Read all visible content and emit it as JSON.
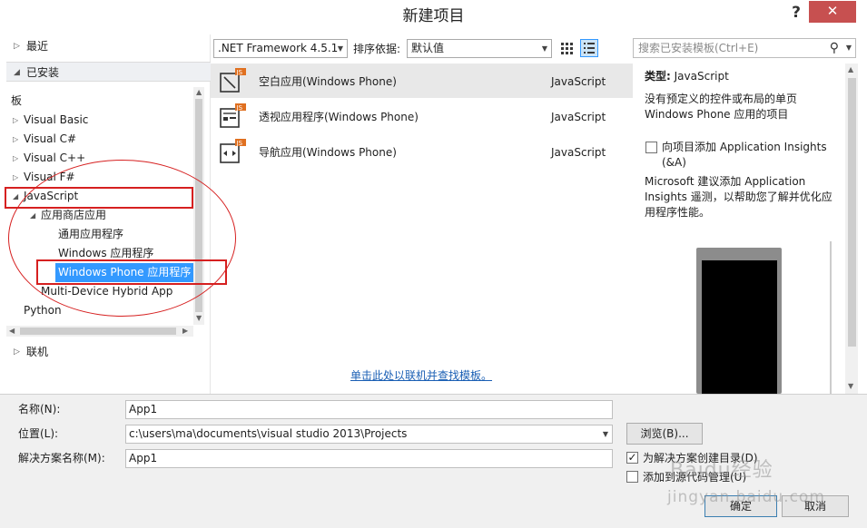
{
  "window": {
    "title": "新建项目",
    "help_label": "?",
    "close_label": "✕"
  },
  "left": {
    "recent_label": "最近",
    "installed_label": "已安装",
    "templates_label": "模板",
    "tree": [
      {
        "label": "Visual Basic"
      },
      {
        "label": "Visual C#"
      },
      {
        "label": "Visual C++"
      },
      {
        "label": "Visual F#"
      },
      {
        "label": "JavaScript"
      },
      {
        "label": "应用商店应用"
      },
      {
        "label": "通用应用程序"
      },
      {
        "label": "Windows 应用程序"
      },
      {
        "label": "Windows Phone 应用程序"
      },
      {
        "label": "Multi-Device Hybrid App"
      },
      {
        "label": "Python"
      }
    ],
    "online_label": "联机"
  },
  "toolbar": {
    "framework_value": ".NET Framework 4.5.1",
    "sort_label": "排序依据:",
    "sort_value": "默认值",
    "search_placeholder": "搜索已安装模板(Ctrl+E)"
  },
  "templates": [
    {
      "name": "空白应用(Windows Phone)",
      "language": "JavaScript",
      "icon": "blank-app-icon"
    },
    {
      "name": "透视应用程序(Windows Phone)",
      "language": "JavaScript",
      "icon": "pivot-app-icon"
    },
    {
      "name": "导航应用(Windows Phone)",
      "language": "JavaScript",
      "icon": "nav-app-icon"
    }
  ],
  "online_link": "单击此处以联机并查找模板。",
  "details": {
    "type_label": "类型:",
    "type_value": "JavaScript",
    "desc_line1": "没有预定义的控件或布局的单页",
    "desc_line2": "Windows Phone 应用的项目",
    "insights_line1": "向项目添加 Application Insights",
    "insights_line2": "(&A)",
    "ms_line1": "Microsoft 建议添加 Application",
    "ms_line2": "Insights 遥测，以帮助您了解并优化应",
    "ms_line3": "用程序性能。"
  },
  "form": {
    "name_label": "名称(N):",
    "name_value": "App1",
    "location_label": "位置(L):",
    "location_value": "c:\\users\\ma\\documents\\visual studio 2013\\Projects",
    "solution_label": "解决方案名称(M):",
    "solution_value": "App1",
    "browse_label": "浏览(B)...",
    "create_dir_label": "为解决方案创建目录(D)",
    "create_dir_checked": true,
    "add_source_label": "添加到源代码管理(U)",
    "add_source_checked": false,
    "ok_label": "确定",
    "cancel_label": "取消"
  },
  "watermark": {
    "line1": "Baidu经验",
    "line2": "jingyan.baidu.com"
  },
  "colors": {
    "selection": "#3399ff",
    "annotation_red": "#d62020",
    "close_button": "#c75050"
  }
}
